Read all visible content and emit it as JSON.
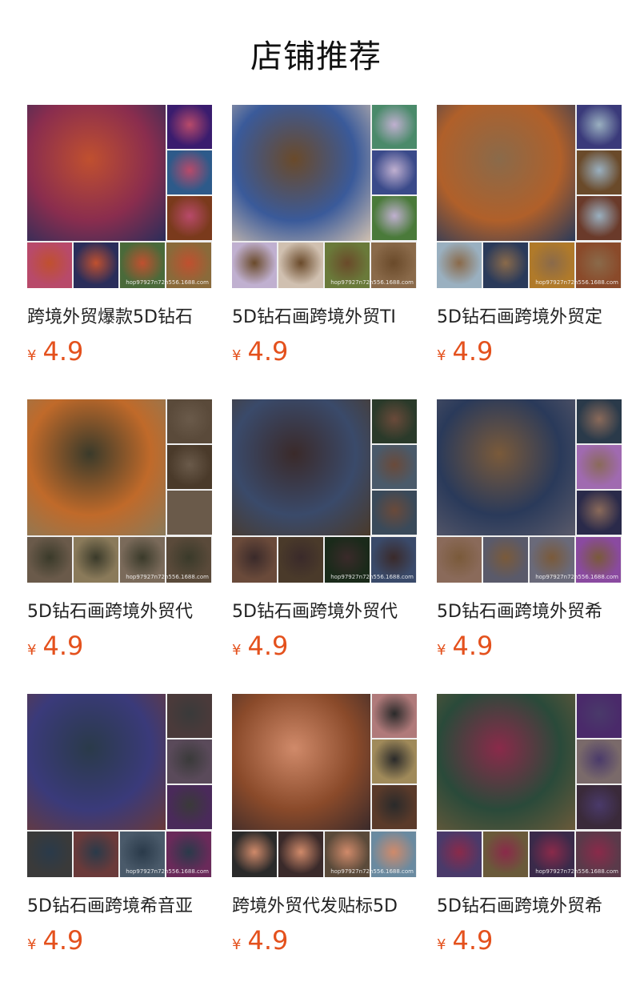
{
  "section": {
    "title": "店铺推荐"
  },
  "products": [
    {
      "name": "跨境外贸爆款5D钻石",
      "currency": "¥",
      "price": "4.9",
      "watermark": "hop97927n72n556.1688.com",
      "colors": {
        "main": "#8a2d4e",
        "a": "#c0502f",
        "b": "#3a1c6e",
        "c": "#2d5a8a",
        "d": "#7a3a1c",
        "e": "#b84a6a",
        "f": "#2a2d5a",
        "g": "#4a6a3a",
        "h": "#8a6a3a"
      }
    },
    {
      "name": "5D钻石画跨境外贸TI",
      "currency": "¥",
      "price": "4.9",
      "watermark": "hop97927n72n556.1688.com",
      "colors": {
        "main": "#3a5a9a",
        "a": "#6a4a2a",
        "b": "#4a8a6a",
        "c": "#3a4a8a",
        "d": "#4a7a3a",
        "e": "#c0b0d0",
        "f": "#d0c0b0",
        "g": "#6a7a3a",
        "h": "#8a6a4a"
      }
    },
    {
      "name": "5D钻石画跨境外贸定",
      "currency": "¥",
      "price": "4.9",
      "watermark": "hop97927n72n556.1688.com",
      "colors": {
        "main": "#b0602a",
        "a": "#8a6a4a",
        "b": "#3a3a7a",
        "c": "#6a4a2a",
        "d": "#6a3a2a",
        "e": "#9ab0c0",
        "f": "#2a3a5a",
        "g": "#b07a2a",
        "h": "#8a4a2a"
      }
    },
    {
      "name": "5D钻石画跨境外贸代",
      "currency": "¥",
      "price": "4.9",
      "watermark": "hop97927n72n556.1688.com",
      "colors": {
        "main": "#c06a2a",
        "a": "#3a3a2a",
        "b": "#5a4a3a",
        "c": "#4a3a2a",
        "d": "#6a5a4a",
        "e": "#6a5a4a",
        "f": "#8a7a5a",
        "g": "#7a6a5a",
        "h": "#5a4a3a"
      }
    },
    {
      "name": "5D钻石画跨境外贸代",
      "currency": "¥",
      "price": "4.9",
      "watermark": "hop97927n72n556.1688.com",
      "colors": {
        "main": "#3a4a6a",
        "a": "#3a2a2a",
        "b": "#2a3a2a",
        "c": "#4a5a6a",
        "d": "#3a4a5a",
        "e": "#6a4a3a",
        "f": "#4a3a2a",
        "g": "#1a2a1a",
        "h": "#3a4a6a"
      }
    },
    {
      "name": "5D钻石画跨境外贸希",
      "currency": "¥",
      "price": "4.9",
      "watermark": "hop97927n72n556.1688.com",
      "colors": {
        "main": "#2a3a5a",
        "a": "#7a5a3a",
        "b": "#2a3a4a",
        "c": "#a06ab0",
        "d": "#2a2a4a",
        "e": "#8a6a5a",
        "f": "#5a5a6a",
        "g": "#6a6a7a",
        "h": "#8a4aa0"
      }
    },
    {
      "name": "5D钻石画跨境希音亚",
      "currency": "¥",
      "price": "4.9",
      "watermark": "hop97927n72n556.1688.com",
      "colors": {
        "main": "#3a3a7a",
        "a": "#2a3a4a",
        "b": "#4a3a3a",
        "c": "#5a4a5a",
        "d": "#4a2a5a",
        "e": "#3a3a3a",
        "f": "#6a3a3a",
        "g": "#4a5a6a",
        "h": "#6a2a5a"
      }
    },
    {
      "name": "跨境外贸代发贴标5D",
      "currency": "¥",
      "price": "4.9",
      "watermark": "hop97927n72n556.1688.com",
      "colors": {
        "main": "#8a4a2a",
        "a": "#d08a6a",
        "b": "#b07a7a",
        "c": "#a08a5a",
        "d": "#5a3a2a",
        "e": "#2a2a2a",
        "f": "#3a2a2a",
        "g": "#5a4a3a",
        "h": "#6a8aa0"
      }
    },
    {
      "name": "5D钻石画跨境外贸希",
      "currency": "¥",
      "price": "4.9",
      "watermark": "hop97927n72n556.1688.com",
      "colors": {
        "main": "#2a4a3a",
        "a": "#8a2a4a",
        "b": "#4a2a6a",
        "c": "#7a6a6a",
        "d": "#3a2a3a",
        "e": "#4a3a6a",
        "f": "#6a5a3a",
        "g": "#3a2a4a",
        "h": "#5a3a4a"
      }
    }
  ]
}
